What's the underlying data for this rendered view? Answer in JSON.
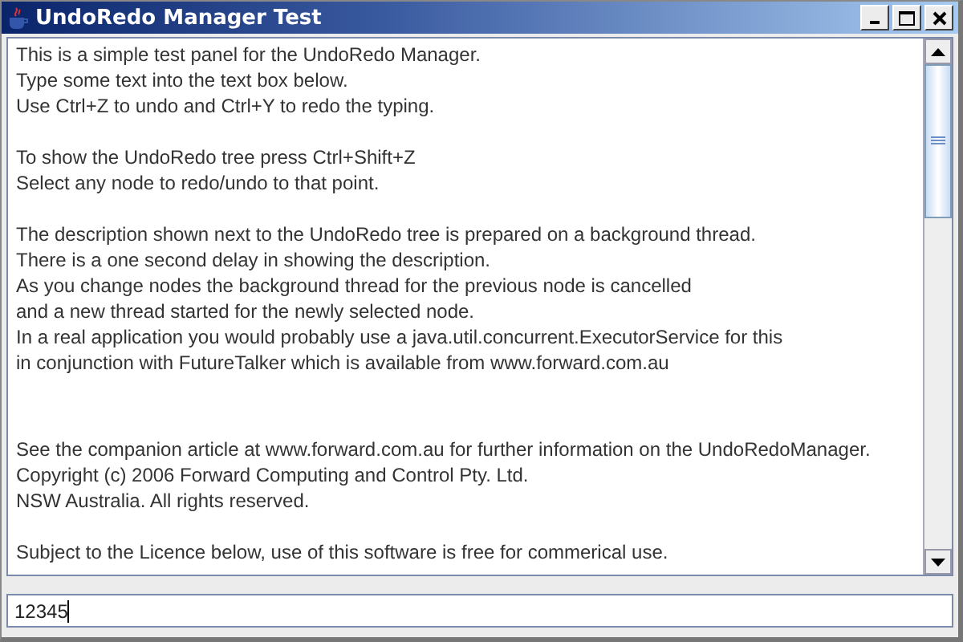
{
  "window": {
    "title": "UndoRedo Manager Test"
  },
  "text_area": {
    "paragraphs": [
      [
        "This is a simple test panel for the UndoRedo Manager.",
        "Type some text into the text box below.",
        "Use Ctrl+Z to undo and Ctrl+Y to redo the typing."
      ],
      [
        "To show the UndoRedo tree press Ctrl+Shift+Z",
        "Select any node to redo/undo to that point."
      ],
      [
        "The description shown next to the UndoRedo tree is prepared on a background thread.",
        "There is a one second delay in showing the description.",
        "As you change nodes the background thread for the previous node is cancelled",
        "and a new thread started for the newly selected node.",
        "In a real application you would probably use a java.util.concurrent.ExecutorService for this",
        "in conjunction with FutureTalker which is available from www.forward.com.au"
      ],
      [
        "See the companion article at www.forward.com.au for further information on the UndoRedoManager.",
        "Copyright (c) 2006  Forward Computing and Control Pty. Ltd.",
        "NSW Australia.  All rights reserved."
      ],
      [
        "Subject to the Licence below, use of this software is free for commerical use."
      ]
    ]
  },
  "input": {
    "value": "12345"
  }
}
